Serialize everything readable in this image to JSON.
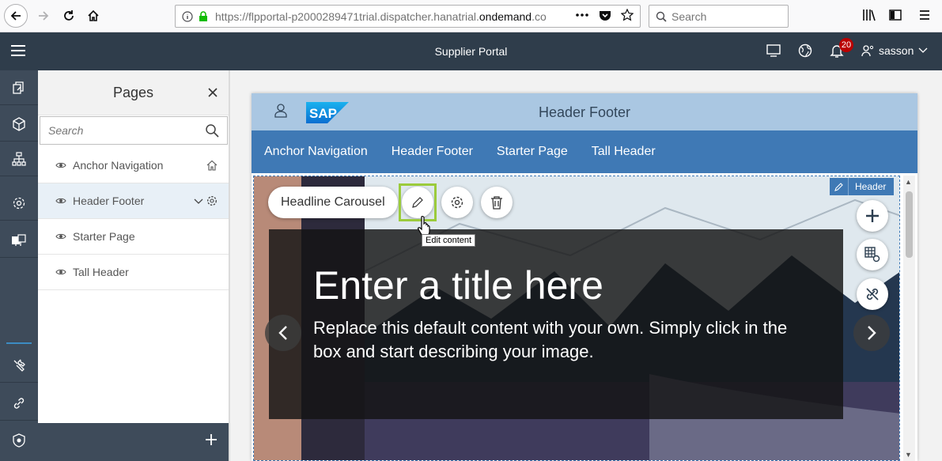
{
  "browser": {
    "url_prefix": "https://flpportal-p2000289471trial.dispatcher.hanatrial.",
    "url_domain": "ondemand",
    "url_suffix": ".co",
    "search_placeholder": "Search"
  },
  "shell": {
    "title": "Supplier Portal",
    "notification_count": "20",
    "user_name": "sasson"
  },
  "pages_panel": {
    "title": "Pages",
    "search_placeholder": "Search",
    "items": [
      {
        "label": "Anchor Navigation"
      },
      {
        "label": "Header Footer"
      },
      {
        "label": "Starter Page"
      },
      {
        "label": "Tall Header"
      }
    ]
  },
  "site": {
    "header_title": "Header Footer",
    "logo_text": "SAP",
    "nav": [
      {
        "label": "Anchor Navigation"
      },
      {
        "label": "Header Footer"
      },
      {
        "label": "Starter Page"
      },
      {
        "label": "Tall Header"
      }
    ]
  },
  "editor": {
    "header_tag": "Header",
    "widget_label": "Headline Carousel",
    "tooltip": "Edit content"
  },
  "carousel": {
    "title": "Enter a title here",
    "text": "Replace this default content with your own. Simply click in the box and start describing your image."
  },
  "colors": {
    "shell": "#2f3d4b",
    "site_nav": "#3f79b5",
    "site_header": "#aac7e2",
    "highlight": "#9bcb3c"
  }
}
